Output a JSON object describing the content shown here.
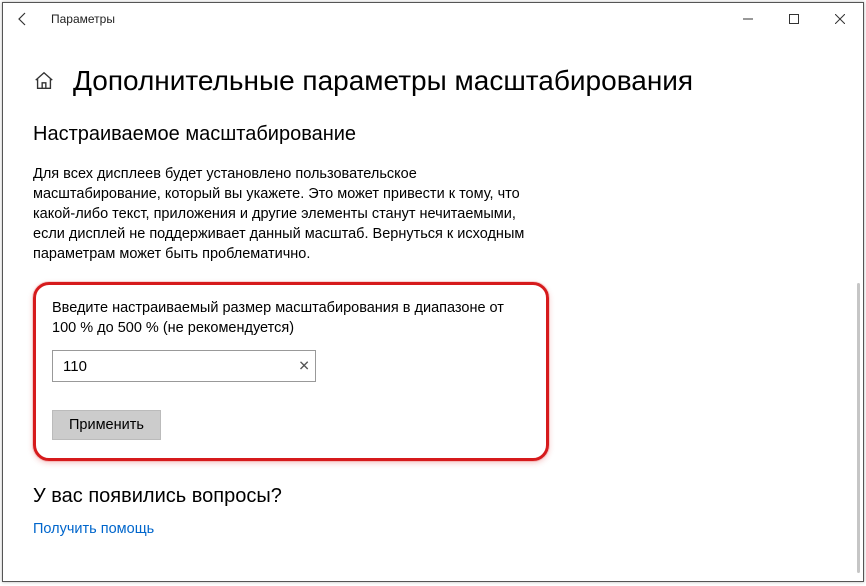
{
  "titlebar": {
    "title": "Параметры"
  },
  "page": {
    "title": "Дополнительные параметры масштабирования"
  },
  "section": {
    "title": "Настраиваемое масштабирование",
    "description": "Для всех дисплеев будет установлено пользовательское масштабирование, который вы укажете. Это может привести к тому, что какой-либо текст, приложения и другие элементы станут нечитаемыми, если дисплей не поддерживает данный масштаб. Вернуться к исходным параметрам может быть проблематично."
  },
  "scaling": {
    "input_label": "Введите настраиваемый размер масштабирования в диапазоне от 100 % до 500 % (не рекомендуется)",
    "value": "110",
    "apply_label": "Применить"
  },
  "help": {
    "question": "У вас появились вопросы?",
    "link": "Получить помощь"
  }
}
